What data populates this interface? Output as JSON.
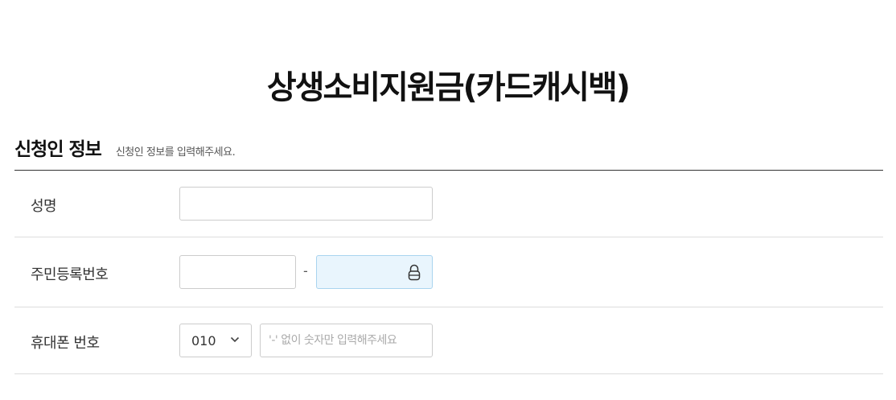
{
  "page": {
    "title": "상생소비지원금(카드캐시백)"
  },
  "section": {
    "title": "신청인 정보",
    "description": "신청인 정보를 입력해주세요."
  },
  "form": {
    "name": {
      "label": "성명",
      "value": ""
    },
    "rrn": {
      "label": "주민등록번호",
      "front_value": "",
      "separator": "-",
      "back_value": "",
      "back_icon": "lock-icon"
    },
    "phone": {
      "label": "휴대폰 번호",
      "prefix_selected": "010",
      "number_placeholder": "'-' 없이 숫자만 입력해주세요",
      "number_value": ""
    }
  },
  "colors": {
    "text_dark": "#111111",
    "border": "#cccccc",
    "secure_field_bg": "#e9f5fd",
    "secure_field_border": "#a9d4ef"
  }
}
